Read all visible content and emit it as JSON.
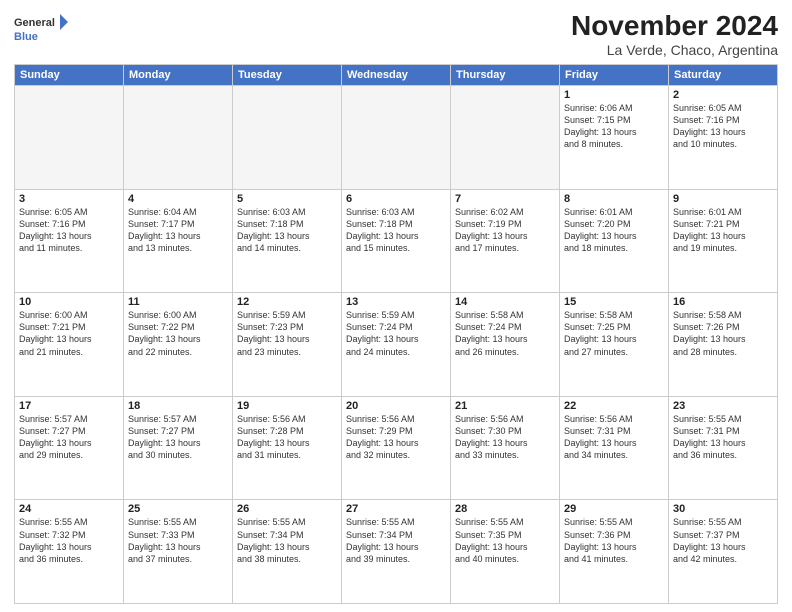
{
  "header": {
    "logo_line1": "General",
    "logo_line2": "Blue",
    "month": "November 2024",
    "location": "La Verde, Chaco, Argentina"
  },
  "weekdays": [
    "Sunday",
    "Monday",
    "Tuesday",
    "Wednesday",
    "Thursday",
    "Friday",
    "Saturday"
  ],
  "weeks": [
    [
      {
        "day": "",
        "info": ""
      },
      {
        "day": "",
        "info": ""
      },
      {
        "day": "",
        "info": ""
      },
      {
        "day": "",
        "info": ""
      },
      {
        "day": "",
        "info": ""
      },
      {
        "day": "1",
        "info": "Sunrise: 6:06 AM\nSunset: 7:15 PM\nDaylight: 13 hours\nand 8 minutes."
      },
      {
        "day": "2",
        "info": "Sunrise: 6:05 AM\nSunset: 7:16 PM\nDaylight: 13 hours\nand 10 minutes."
      }
    ],
    [
      {
        "day": "3",
        "info": "Sunrise: 6:05 AM\nSunset: 7:16 PM\nDaylight: 13 hours\nand 11 minutes."
      },
      {
        "day": "4",
        "info": "Sunrise: 6:04 AM\nSunset: 7:17 PM\nDaylight: 13 hours\nand 13 minutes."
      },
      {
        "day": "5",
        "info": "Sunrise: 6:03 AM\nSunset: 7:18 PM\nDaylight: 13 hours\nand 14 minutes."
      },
      {
        "day": "6",
        "info": "Sunrise: 6:03 AM\nSunset: 7:18 PM\nDaylight: 13 hours\nand 15 minutes."
      },
      {
        "day": "7",
        "info": "Sunrise: 6:02 AM\nSunset: 7:19 PM\nDaylight: 13 hours\nand 17 minutes."
      },
      {
        "day": "8",
        "info": "Sunrise: 6:01 AM\nSunset: 7:20 PM\nDaylight: 13 hours\nand 18 minutes."
      },
      {
        "day": "9",
        "info": "Sunrise: 6:01 AM\nSunset: 7:21 PM\nDaylight: 13 hours\nand 19 minutes."
      }
    ],
    [
      {
        "day": "10",
        "info": "Sunrise: 6:00 AM\nSunset: 7:21 PM\nDaylight: 13 hours\nand 21 minutes."
      },
      {
        "day": "11",
        "info": "Sunrise: 6:00 AM\nSunset: 7:22 PM\nDaylight: 13 hours\nand 22 minutes."
      },
      {
        "day": "12",
        "info": "Sunrise: 5:59 AM\nSunset: 7:23 PM\nDaylight: 13 hours\nand 23 minutes."
      },
      {
        "day": "13",
        "info": "Sunrise: 5:59 AM\nSunset: 7:24 PM\nDaylight: 13 hours\nand 24 minutes."
      },
      {
        "day": "14",
        "info": "Sunrise: 5:58 AM\nSunset: 7:24 PM\nDaylight: 13 hours\nand 26 minutes."
      },
      {
        "day": "15",
        "info": "Sunrise: 5:58 AM\nSunset: 7:25 PM\nDaylight: 13 hours\nand 27 minutes."
      },
      {
        "day": "16",
        "info": "Sunrise: 5:58 AM\nSunset: 7:26 PM\nDaylight: 13 hours\nand 28 minutes."
      }
    ],
    [
      {
        "day": "17",
        "info": "Sunrise: 5:57 AM\nSunset: 7:27 PM\nDaylight: 13 hours\nand 29 minutes."
      },
      {
        "day": "18",
        "info": "Sunrise: 5:57 AM\nSunset: 7:27 PM\nDaylight: 13 hours\nand 30 minutes."
      },
      {
        "day": "19",
        "info": "Sunrise: 5:56 AM\nSunset: 7:28 PM\nDaylight: 13 hours\nand 31 minutes."
      },
      {
        "day": "20",
        "info": "Sunrise: 5:56 AM\nSunset: 7:29 PM\nDaylight: 13 hours\nand 32 minutes."
      },
      {
        "day": "21",
        "info": "Sunrise: 5:56 AM\nSunset: 7:30 PM\nDaylight: 13 hours\nand 33 minutes."
      },
      {
        "day": "22",
        "info": "Sunrise: 5:56 AM\nSunset: 7:31 PM\nDaylight: 13 hours\nand 34 minutes."
      },
      {
        "day": "23",
        "info": "Sunrise: 5:55 AM\nSunset: 7:31 PM\nDaylight: 13 hours\nand 36 minutes."
      }
    ],
    [
      {
        "day": "24",
        "info": "Sunrise: 5:55 AM\nSunset: 7:32 PM\nDaylight: 13 hours\nand 36 minutes."
      },
      {
        "day": "25",
        "info": "Sunrise: 5:55 AM\nSunset: 7:33 PM\nDaylight: 13 hours\nand 37 minutes."
      },
      {
        "day": "26",
        "info": "Sunrise: 5:55 AM\nSunset: 7:34 PM\nDaylight: 13 hours\nand 38 minutes."
      },
      {
        "day": "27",
        "info": "Sunrise: 5:55 AM\nSunset: 7:34 PM\nDaylight: 13 hours\nand 39 minutes."
      },
      {
        "day": "28",
        "info": "Sunrise: 5:55 AM\nSunset: 7:35 PM\nDaylight: 13 hours\nand 40 minutes."
      },
      {
        "day": "29",
        "info": "Sunrise: 5:55 AM\nSunset: 7:36 PM\nDaylight: 13 hours\nand 41 minutes."
      },
      {
        "day": "30",
        "info": "Sunrise: 5:55 AM\nSunset: 7:37 PM\nDaylight: 13 hours\nand 42 minutes."
      }
    ]
  ]
}
